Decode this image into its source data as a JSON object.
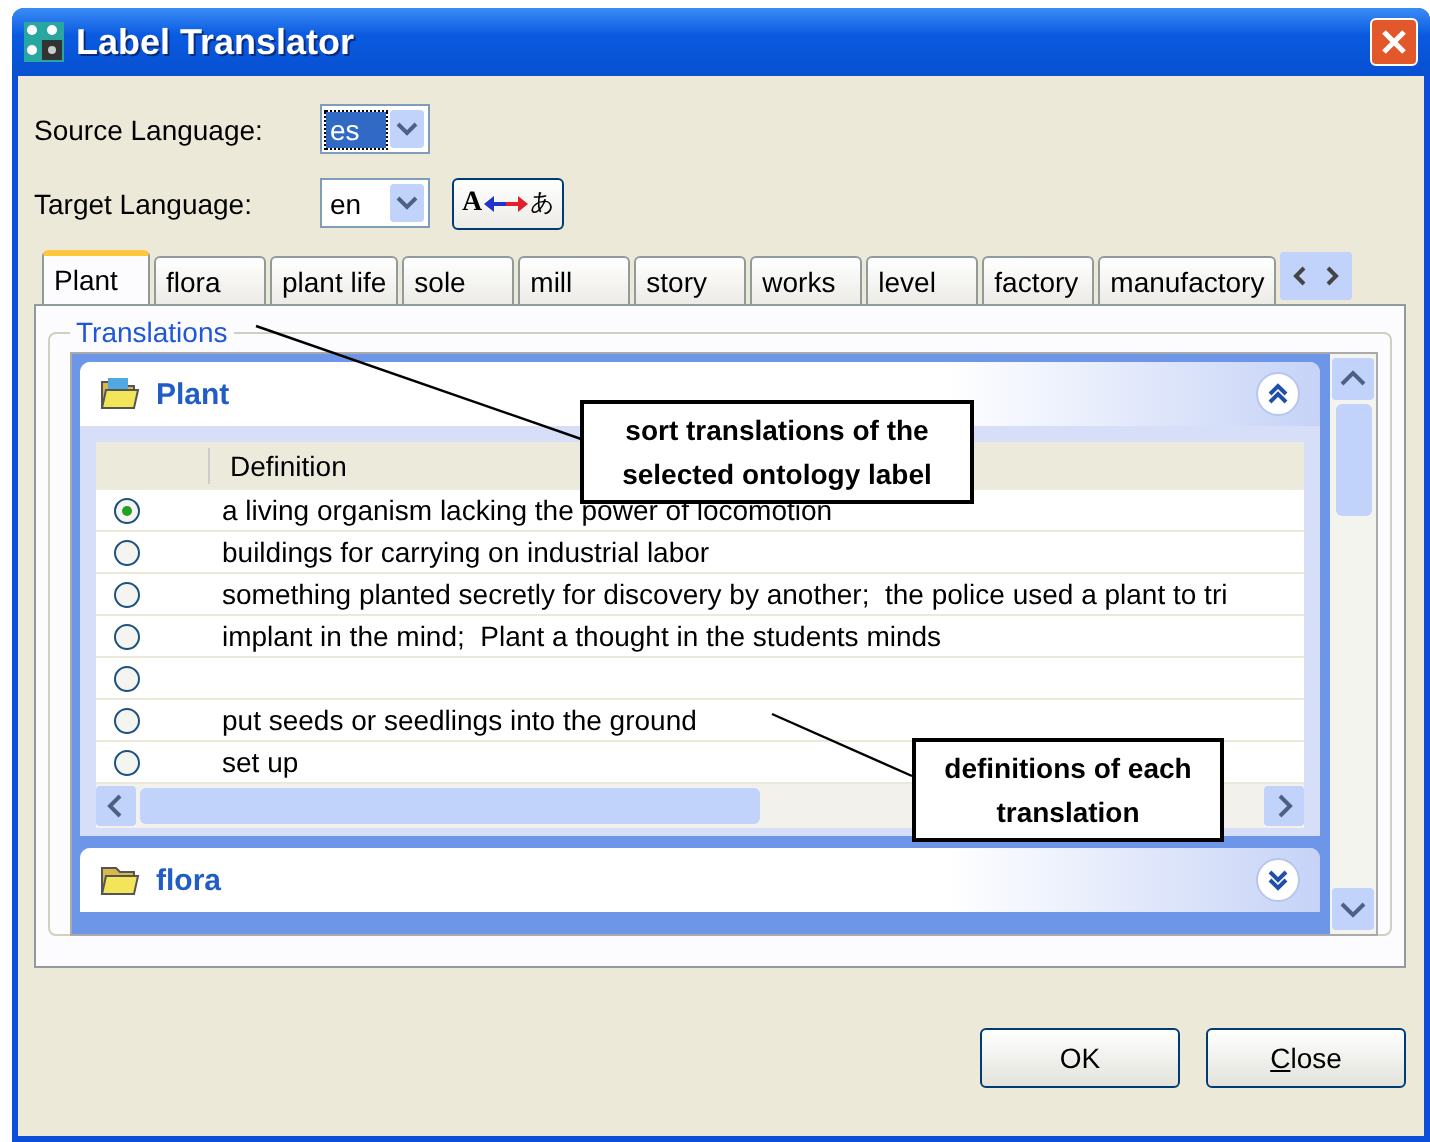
{
  "window": {
    "title": "Label Translator"
  },
  "source_language": {
    "label": "Source Language:",
    "value": "es",
    "focused": true
  },
  "target_language": {
    "label": "Target Language:",
    "value": "en",
    "focused": false
  },
  "translate_button": {
    "from": "A",
    "to": "あ"
  },
  "tabs": [
    {
      "label": "Plant",
      "selected": true
    },
    {
      "label": "flora",
      "selected": false
    },
    {
      "label": "plant life",
      "selected": false
    },
    {
      "label": "sole",
      "selected": false
    },
    {
      "label": "mill",
      "selected": false
    },
    {
      "label": "story",
      "selected": false
    },
    {
      "label": "works",
      "selected": false
    },
    {
      "label": "level",
      "selected": false
    },
    {
      "label": "factory",
      "selected": false
    },
    {
      "label": "manufactory",
      "selected": false
    }
  ],
  "group": {
    "title": "Translations"
  },
  "panels": [
    {
      "title": "Plant",
      "expanded": true,
      "column": "Definition",
      "rows": [
        {
          "selected": true,
          "definition": "a living organism lacking the power of locomotion"
        },
        {
          "selected": false,
          "definition": "buildings for carrying on industrial labor"
        },
        {
          "selected": false,
          "definition": "something planted secretly for discovery by another;  the police used a plant to tri"
        },
        {
          "selected": false,
          "definition": "implant in the mind;  Plant a thought in the students minds"
        },
        {
          "selected": false
        },
        {
          "selected": false,
          "definition": "put seeds or seedlings into the ground"
        },
        {
          "selected": false,
          "definition": "set up"
        }
      ]
    },
    {
      "title": "flora",
      "expanded": false
    }
  ],
  "callouts": [
    {
      "text": "sort translations of the selected ontology label"
    },
    {
      "text": "definitions of each translation"
    }
  ],
  "buttons": [
    {
      "label": "OK",
      "underline_first": false
    },
    {
      "label": "Close",
      "underline_first": true
    }
  ]
}
